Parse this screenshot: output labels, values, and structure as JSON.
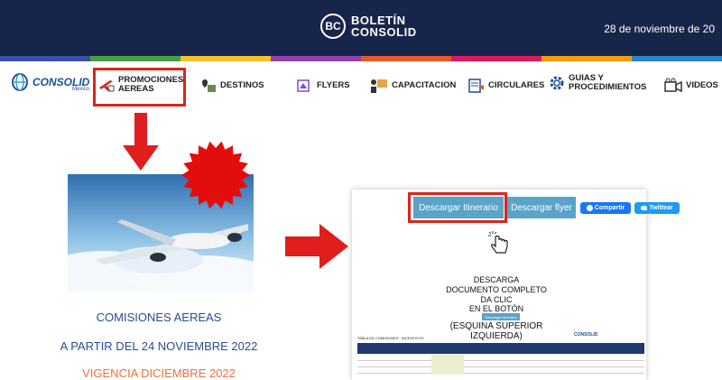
{
  "header": {
    "logo_initials": "BC",
    "title_line1": "BOLETÍN",
    "title_line2": "CONSOLID",
    "date": "28 de noviembre de 20",
    "bar_colors": [
      "#3b4fa0",
      "#43a047",
      "#f2c230",
      "#8e44ad",
      "#e35a2b",
      "#d81b60",
      "#f39c12",
      "#2e86c1"
    ]
  },
  "nav": {
    "brand": "CONSOLID",
    "brand_sub": "México",
    "items": [
      {
        "label1": "PROMOCIONES",
        "label2": "AEREAS",
        "icon": "plane-tag-icon"
      },
      {
        "label1": "DESTINOS",
        "label2": "",
        "icon": "map-pin-icon"
      },
      {
        "label1": "FLYERS",
        "label2": "",
        "icon": "flyer-icon"
      },
      {
        "label1": "CAPACITACION",
        "label2": "",
        "icon": "presentation-icon"
      },
      {
        "label1": "CIRCULARES",
        "label2": "",
        "icon": "document-icon"
      },
      {
        "label1": "GUIAS Y",
        "label2": "PROCEDIMIENTOS",
        "icon": "gear-icon"
      },
      {
        "label1": "VIDEOS",
        "label2": "",
        "icon": "video-camera-icon"
      }
    ]
  },
  "promo": {
    "caption_title": "COMISIONES AEREAS",
    "caption_from": "A PARTIR DEL 24 NOVIEMBRE 2022",
    "caption_validity": "VIGENCIA DICIEMBRE 2022"
  },
  "download_page": {
    "btn_itinerary": "Descargar Itinerario",
    "btn_flyer": "Descargar flyer",
    "btn_share": "Compartir",
    "btn_tweet": "Twittear",
    "instruction_lines": [
      "DESCARGA",
      "DOCUMENTO COMPLETO",
      "DA CLIC",
      "EN EL BOTÓN"
    ],
    "mini_button": "Descargar Itinerario",
    "corner_note": "(ESQUINA SUPERIOR IZQUIERDA)",
    "table_title": "TABLA DE COMISIONES - INCENTIVOS",
    "table_logo": "CONSOLID"
  },
  "colors": {
    "header_bg": "#18254a",
    "highlight_red": "#d9261c",
    "button_blue": "#59a4c8",
    "caption_blue": "#2a4d8f",
    "caption_orange": "#f0713a"
  }
}
